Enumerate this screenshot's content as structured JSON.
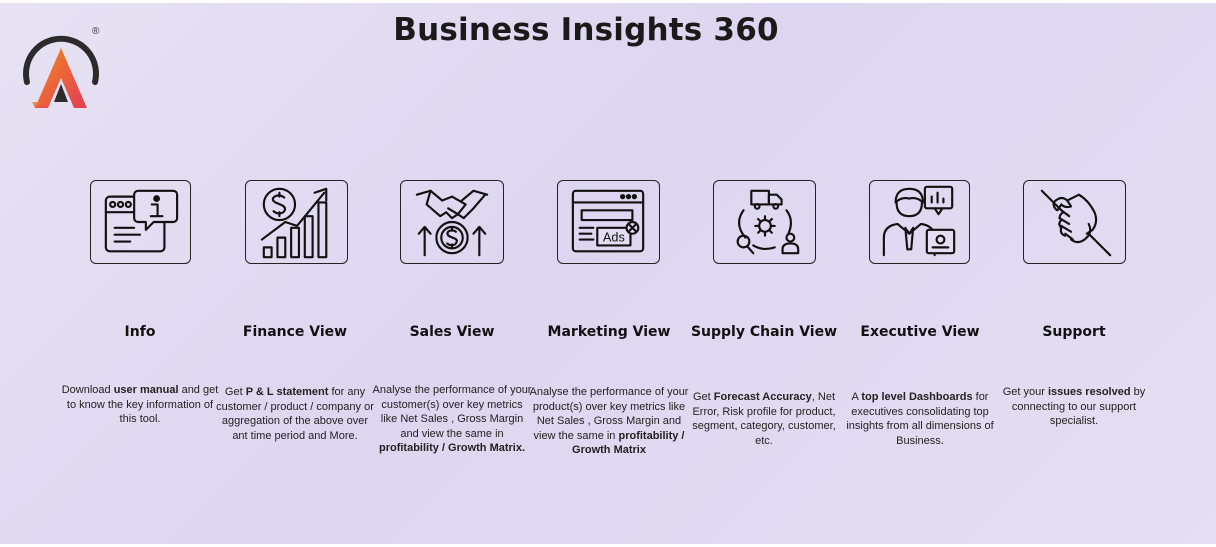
{
  "app": {
    "title": "Business Insights 360"
  },
  "logo": {
    "name": "A",
    "mark": "®",
    "colors": {
      "ring": "#2b2b2b",
      "gradient_start": "#f28a1e",
      "gradient_end": "#e23c56"
    }
  },
  "cards": [
    {
      "title": "Info",
      "icon": "info-icon",
      "desc": [
        "Download ",
        {
          "b": "user manual"
        },
        " and get to know the key information of this tool."
      ]
    },
    {
      "title": "Finance View",
      "icon": "finance-growth-icon",
      "desc": [
        "Get ",
        {
          "b": "P & L statement"
        },
        " for any customer / product / company or aggregation of the above over ant time period and More."
      ]
    },
    {
      "title": "Sales View",
      "icon": "handshake-icon",
      "desc": [
        "Analyse the performance of your customer(s) over key metrics like Net Sales , Gross Margin and view the same in ",
        {
          "b": "profitability / Growth Matrix."
        }
      ]
    },
    {
      "title": "Marketing View",
      "icon": "ads-icon",
      "desc": [
        "Analyse the performance of your product(s) over key metrics like Net Sales , Gross Margin and view the same in ",
        {
          "b": "profitability / Growth Matrix"
        }
      ]
    },
    {
      "title": "Supply Chain View",
      "icon": "supply-chain-icon",
      "desc": [
        "Get ",
        {
          "b": "Forecast Accuracy"
        },
        ", Net Error, Risk profile for product, segment, category, customer, etc."
      ]
    },
    {
      "title": "Executive View",
      "icon": "executive-icon",
      "desc": [
        "A ",
        {
          "b": "top level Dashboards"
        },
        " for executives consolidating top insights from all dimensions of Business."
      ]
    },
    {
      "title": "Support",
      "icon": "support-hands-icon",
      "desc": [
        "Get your ",
        {
          "b": "issues resolved"
        },
        " by connecting to our support specialist."
      ]
    }
  ]
}
